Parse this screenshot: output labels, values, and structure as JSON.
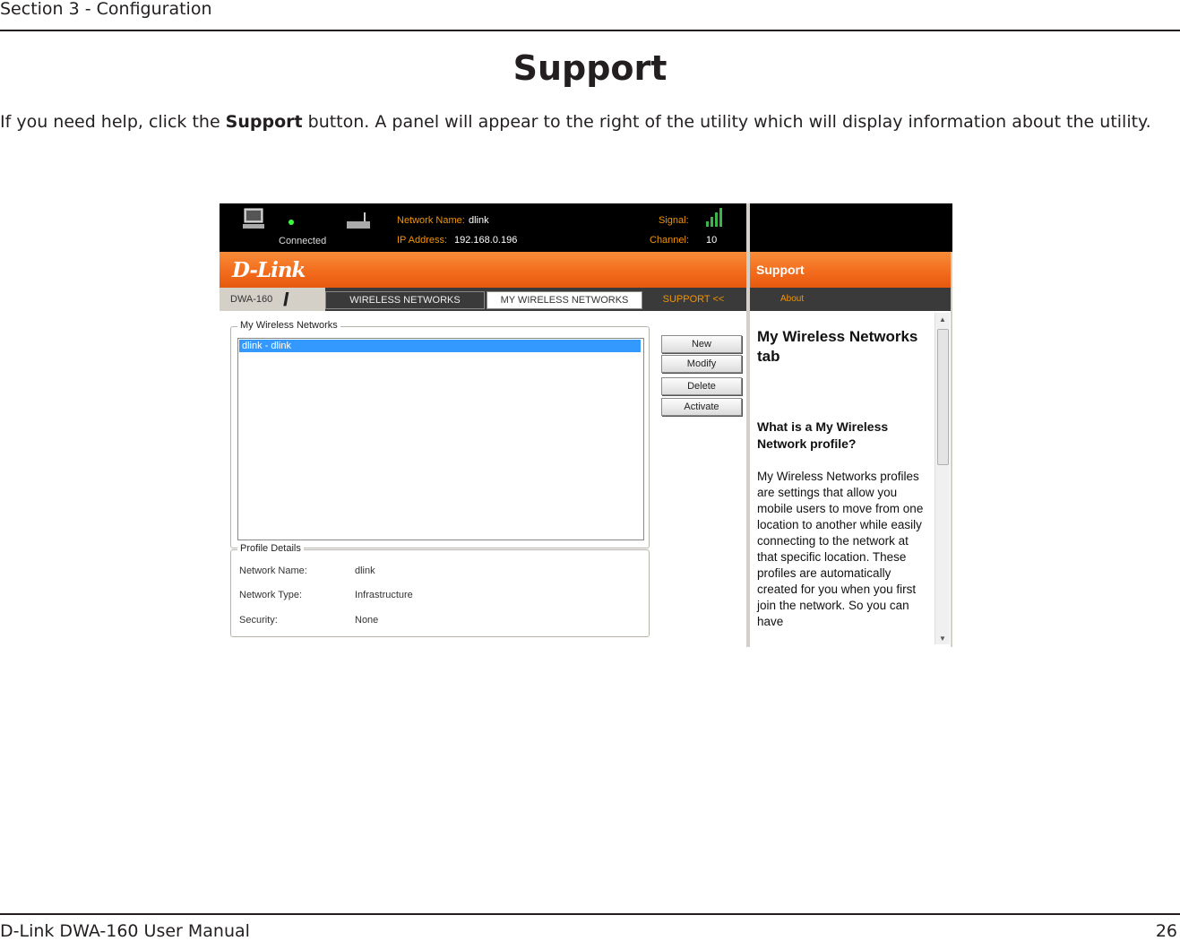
{
  "page": {
    "section": "Section 3 - Configuration",
    "title": "Support",
    "intro_before": "If you need help, click the ",
    "intro_bold": "Support",
    "intro_after": " button. A panel will appear to the right of the utility which will display information about the utility.",
    "footer_left": "D-Link DWA-160 User Manual",
    "page_number": "26"
  },
  "utility": {
    "status": {
      "connected_label": "Connected",
      "network_name_label": "Network Name:",
      "network_name_value": "dlink",
      "ip_label": "IP Address:",
      "ip_value": "192.168.0.196",
      "signal_label": "Signal:",
      "signal_bars": 4,
      "channel_label": "Channel:",
      "channel_value": "10",
      "led_color": "#39ff3a"
    },
    "brand": "D-Link",
    "model": "DWA-160",
    "tabs": [
      "WIRELESS NETWORKS",
      "MY WIRELESS NETWORKS",
      "SUPPORT <<"
    ],
    "my_networks": {
      "group_title": "My Wireless Networks",
      "items": [
        "dlink - dlink"
      ],
      "buttons": [
        "New",
        "Modify",
        "Delete",
        "Activate"
      ]
    },
    "profile_details": {
      "group_title": "Profile Details",
      "rows": [
        {
          "label": "Network Name:",
          "value": "dlink"
        },
        {
          "label": "Network Type:",
          "value": "Infrastructure"
        },
        {
          "label": "Security:",
          "value": "None"
        }
      ]
    },
    "accent_color": "#f26a1b"
  },
  "support_panel": {
    "title": "Support",
    "nav_item": "About",
    "heading": "My Wireless Networks tab",
    "subheading": "What is a My Wireless Network profile?",
    "paragraph": "My Wireless Networks profiles are settings that allow you mobile users to move from one location to another while easily connecting to the network at that specific location. These profiles are automatically created for you when you first join the network.  So you can have"
  }
}
